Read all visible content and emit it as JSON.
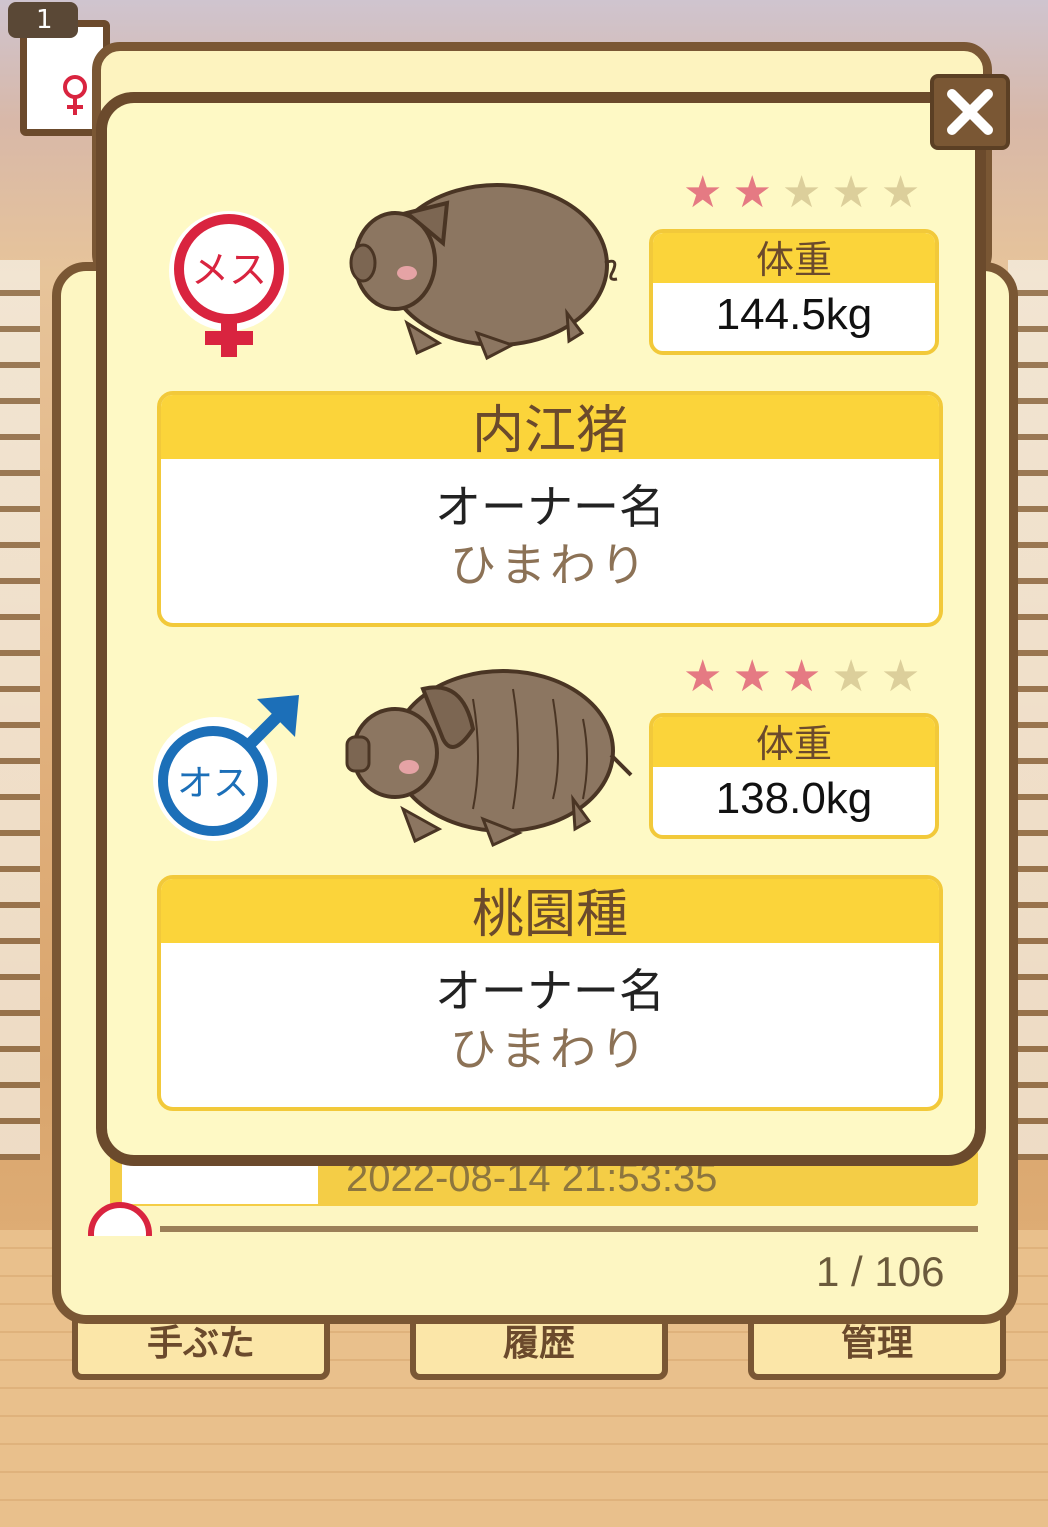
{
  "background": {
    "top_badge": "1",
    "bottom_buttons": [
      "手ぶた",
      "履歴",
      "管理"
    ],
    "list_row_date": "2022-08-14 21:53:35"
  },
  "pager": {
    "text": "1 / 106"
  },
  "modal": {
    "close_icon": "close-x-icon",
    "female": {
      "gender_icon": "female-symbol-icon",
      "gender_text": "メス",
      "stars": {
        "filled": 2,
        "total": 5
      },
      "weight_label": "体重",
      "weight_value": "144.5kg",
      "breed": "内江猪",
      "owner_label": "オーナー名",
      "owner_name": "ひまわり"
    },
    "male": {
      "gender_icon": "male-symbol-icon",
      "gender_text": "オス",
      "stars": {
        "filled": 3,
        "total": 5
      },
      "weight_label": "体重",
      "weight_value": "138.0kg",
      "breed": "桃園種",
      "owner_label": "オーナー名",
      "owner_name": "ひまわり"
    }
  },
  "colors": {
    "panel_border": "#6b4a2c",
    "panel_bg": "#fef9c5",
    "header_yellow": "#fbd43a",
    "female_red": "#d9243f",
    "male_blue": "#1c6fb8",
    "star_on": "#e57a83",
    "star_off": "#dccf9b"
  }
}
